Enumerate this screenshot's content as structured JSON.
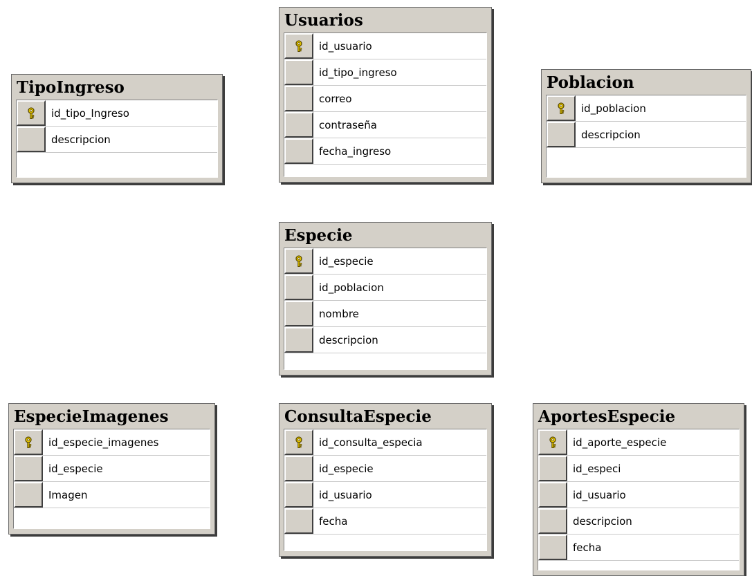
{
  "tables": [
    {
      "id": "tipoingreso",
      "title": "TipoIngreso",
      "columns": [
        {
          "name": "id_tipo_Ingreso",
          "key": true
        },
        {
          "name": "descripcion",
          "key": false
        }
      ]
    },
    {
      "id": "usuarios",
      "title": "Usuarios",
      "columns": [
        {
          "name": "id_usuario",
          "key": true
        },
        {
          "name": "id_tipo_ingreso",
          "key": false
        },
        {
          "name": "correo",
          "key": false
        },
        {
          "name": "contraseña",
          "key": false
        },
        {
          "name": "fecha_ingreso",
          "key": false
        }
      ]
    },
    {
      "id": "poblacion",
      "title": "Poblacion",
      "columns": [
        {
          "name": "id_poblacion",
          "key": true
        },
        {
          "name": "descripcion",
          "key": false
        }
      ]
    },
    {
      "id": "especie",
      "title": "Especie",
      "columns": [
        {
          "name": "id_especie",
          "key": true
        },
        {
          "name": "id_poblacion",
          "key": false
        },
        {
          "name": "nombre",
          "key": false
        },
        {
          "name": "descripcion",
          "key": false
        }
      ]
    },
    {
      "id": "especieimagenes",
      "title": "EspecieImagenes",
      "columns": [
        {
          "name": "id_especie_imagenes",
          "key": true
        },
        {
          "name": "id_especie",
          "key": false
        },
        {
          "name": "Imagen",
          "key": false
        }
      ]
    },
    {
      "id": "consultaespecie",
      "title": "ConsultaEspecie",
      "columns": [
        {
          "name": "id_consulta_especia",
          "key": true
        },
        {
          "name": "id_especie",
          "key": false
        },
        {
          "name": "id_usuario",
          "key": false
        },
        {
          "name": "fecha",
          "key": false
        }
      ]
    },
    {
      "id": "aportesespecie",
      "title": "AportesEspecie",
      "columns": [
        {
          "name": "id_aporte_especie",
          "key": true
        },
        {
          "name": "id_especi",
          "key": false
        },
        {
          "name": "id_usuario",
          "key": false
        },
        {
          "name": "descripcion",
          "key": false
        },
        {
          "name": "fecha",
          "key": false
        }
      ]
    }
  ],
  "colors": {
    "key_icon": "#e8c800",
    "window_face": "#d4d0c8"
  }
}
